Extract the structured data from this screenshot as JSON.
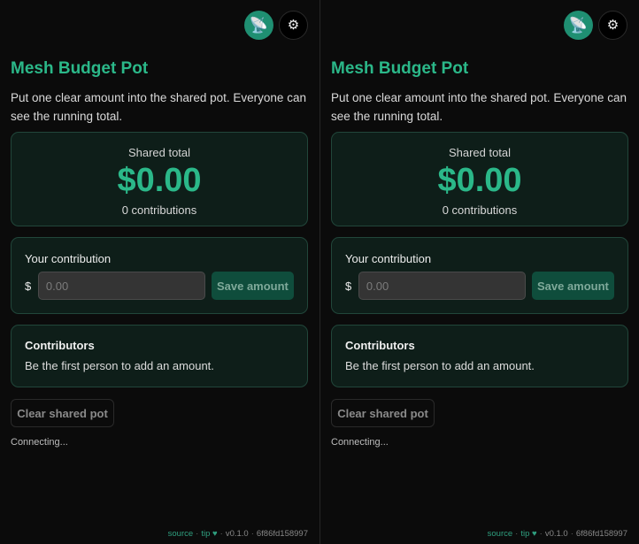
{
  "panels": [
    {
      "topbar": {
        "connect_icon": "satellite-dish",
        "settings_icon": "gear"
      },
      "title": "Mesh Budget Pot",
      "description": "Put one clear amount into the shared pot. Everyone can see the running total.",
      "total": {
        "label": "Shared total",
        "amount": "$0.00",
        "count": "0 contributions"
      },
      "contribution": {
        "label": "Your contribution",
        "currency": "$",
        "placeholder": "0.00",
        "value": "",
        "save_label": "Save amount"
      },
      "contributors": {
        "title": "Contributors",
        "empty_text": "Be the first person to add an amount."
      },
      "clear_label": "Clear shared pot",
      "status": "Connecting...",
      "footer": {
        "source": "source",
        "tip": "tip",
        "heart": "♥",
        "version": "v0.1.0",
        "hash": "6f86fd158997"
      }
    },
    {
      "topbar": {
        "connect_icon": "satellite-dish",
        "settings_icon": "gear"
      },
      "title": "Mesh Budget Pot",
      "description": "Put one clear amount into the shared pot. Everyone can see the running total.",
      "total": {
        "label": "Shared total",
        "amount": "$0.00",
        "count": "0 contributions"
      },
      "contribution": {
        "label": "Your contribution",
        "currency": "$",
        "placeholder": "0.00",
        "value": "",
        "save_label": "Save amount"
      },
      "contributors": {
        "title": "Contributors",
        "empty_text": "Be the first person to add an amount."
      },
      "clear_label": "Clear shared pot",
      "status": "Connecting...",
      "footer": {
        "source": "source",
        "tip": "tip",
        "heart": "♥",
        "version": "v0.1.0",
        "hash": "6f86fd158997"
      }
    }
  ],
  "colors": {
    "accent": "#2bb889",
    "card_bg": "#0e1e19",
    "card_border": "#21463a",
    "button_bg": "#0f4d3c"
  }
}
